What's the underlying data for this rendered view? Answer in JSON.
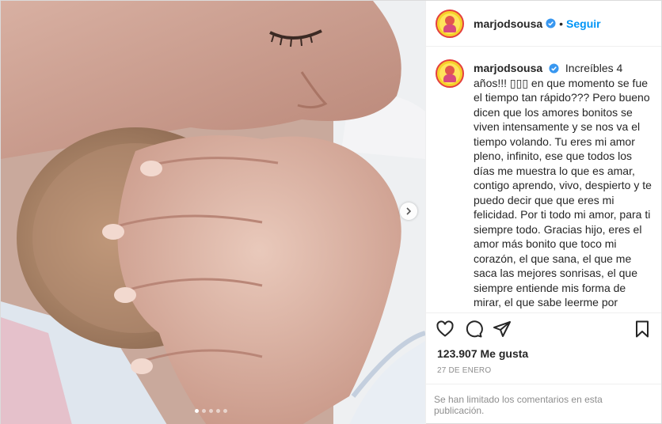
{
  "post": {
    "username": "marjodsousa",
    "follow_label": "Seguir",
    "separator": "•",
    "caption_text": "Increíbles 4 años!!! ▯▯▯ en que momento se fue el tiempo tan rápido??? Pero bueno dicen que los amores bonitos se viven intensamente y se nos va el tiempo volando. Tu eres mi amor pleno, infinito, ese que todos los días me muestra lo que es amar, contigo aprendo, vivo, despierto y te puedo decir que que eres mi felicidad. Por ti todo mi amor, para ti siempre todo. Gracias hijo, eres el amor más bonito que toco mi corazón, el que sana, el que me saca las mejores sonrisas, el que siempre entiende mis forma de mirar, el que sabe leerme por completo, el que por más lejos que este me siente y me cuida. Para ti siempre deseo un mundo lleno de posibilidades infinitas de amor, de",
    "likes": "123.907 Me gusta",
    "date": "27 DE ENERO",
    "comments_limited": "Se han limitado los comentarios en esta publicación."
  },
  "carousel": {
    "slides": 5,
    "active": 0
  },
  "icons": {
    "verified": "verified-badge-icon",
    "like": "heart-icon",
    "comment": "comment-icon",
    "share": "share-icon",
    "save": "bookmark-icon",
    "next": "chevron-right-icon"
  },
  "colors": {
    "accent": "#0095f6",
    "verified": "#3897f0",
    "muted": "#8e8e8e",
    "text": "#262626"
  }
}
